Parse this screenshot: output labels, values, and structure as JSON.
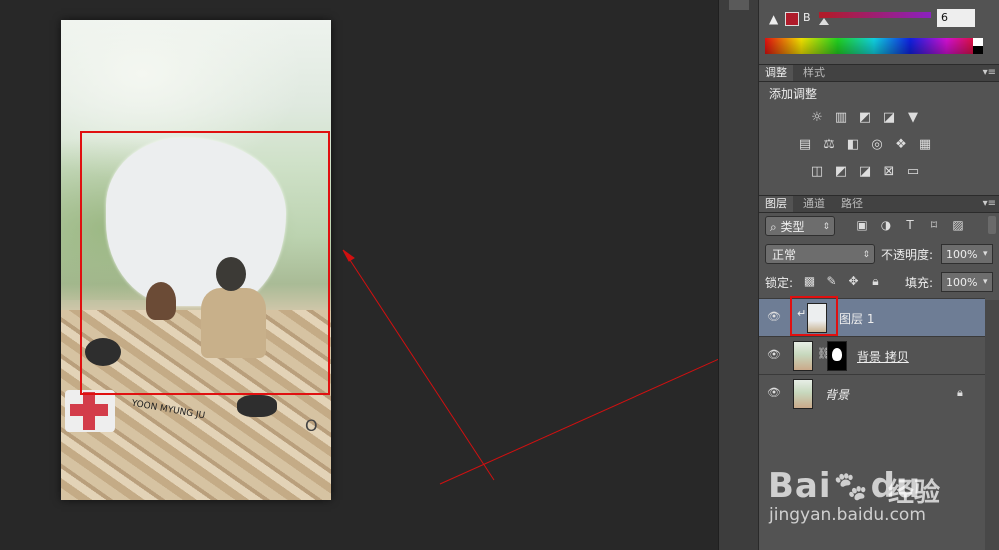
{
  "canvas": {
    "nametag": "YOON MYUNG JU",
    "badge_text": "O"
  },
  "color_panel": {
    "channel_label": "B",
    "channel_value": "6",
    "swatch_color": "#b01c2b"
  },
  "adjustments_panel": {
    "tabs": [
      "调整",
      "样式"
    ],
    "title": "添加调整",
    "icons": [
      "brightness-icon",
      "levels-icon",
      "curves-icon",
      "exposure-icon",
      "vibrance-icon",
      "hue-icon",
      "color-balance-icon",
      "bw-icon",
      "photo-filter-icon",
      "channel-mixer-icon",
      "color-lookup-icon",
      "invert-icon",
      "posterize-icon",
      "threshold-icon",
      "selective-color-icon",
      "gradient-map-icon"
    ]
  },
  "layers_panel": {
    "tabs": [
      "图层",
      "通道",
      "路径"
    ],
    "filter_kind": "类型",
    "blend_mode": "正常",
    "opacity_label": "不透明度:",
    "opacity_value": "100%",
    "lock_label": "锁定:",
    "fill_label": "填充:",
    "fill_value": "100%",
    "layers": [
      {
        "name": "图层 1",
        "selected": true
      },
      {
        "name": "背景 拷贝",
        "selected": false
      },
      {
        "name": "背景",
        "selected": false
      }
    ]
  },
  "watermark": {
    "logo_text": "Bai",
    "logo_text2": "du",
    "cn_text": "经验",
    "url": "jingyan.baidu.com"
  }
}
